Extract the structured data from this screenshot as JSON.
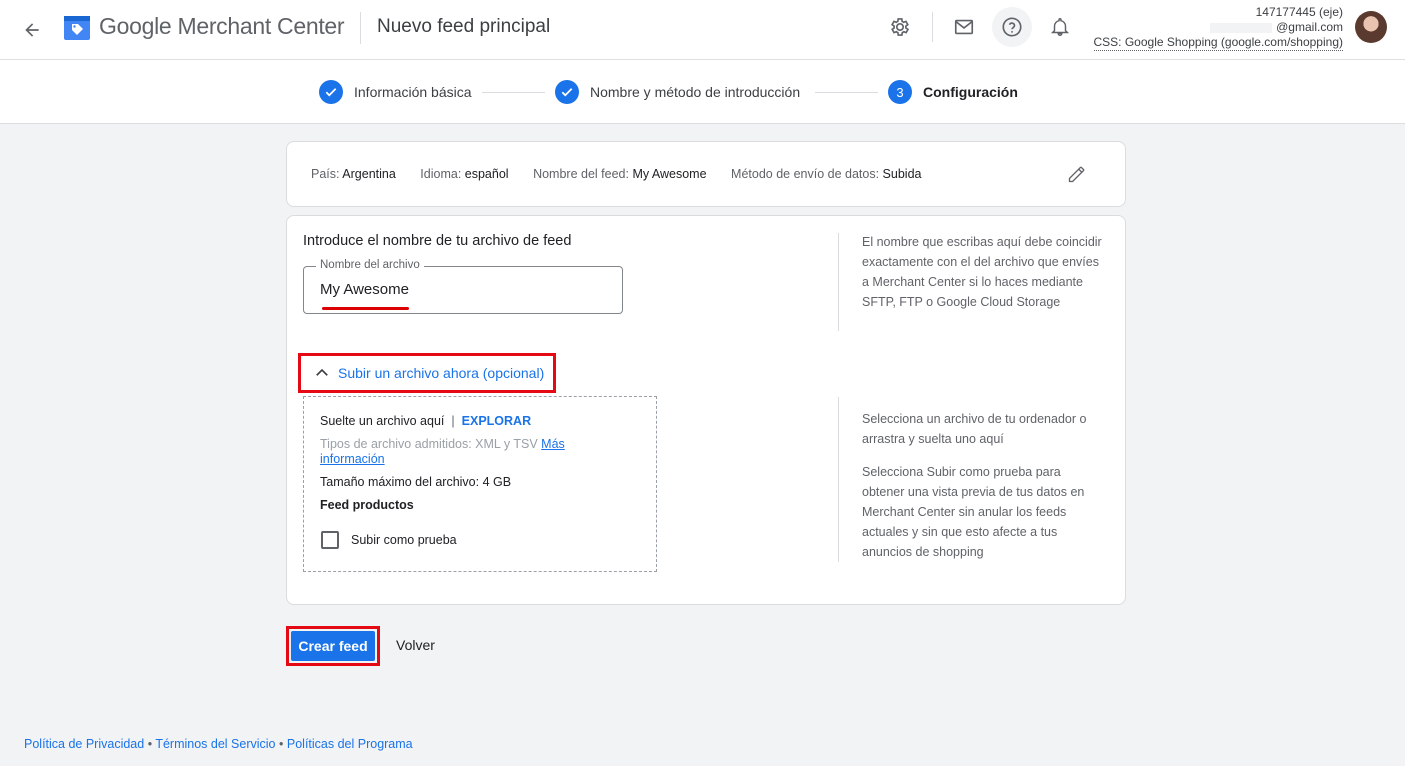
{
  "header": {
    "brand_google": "Google",
    "brand_product": "Merchant Center",
    "page_title": "Nuevo feed principal",
    "icons": [
      "back-arrow-icon",
      "settings-gear-icon",
      "mail-icon",
      "help-icon",
      "notifications-bell-icon"
    ],
    "account": {
      "id": "147177445 (eje)",
      "email": "@gmail.com",
      "css": "CSS: Google Shopping (google.com/shopping)"
    }
  },
  "stepper": {
    "steps": [
      {
        "label": "Información básica",
        "state": "done"
      },
      {
        "label": "Nombre y método de introducción",
        "state": "done"
      },
      {
        "label": "Configuración",
        "state": "current",
        "number": "3"
      }
    ]
  },
  "summary": {
    "country_label": "País:",
    "country_value": "Argentina",
    "language_label": "Idioma:",
    "language_value": "español",
    "feed_name_label": "Nombre del feed:",
    "feed_name_value": "My Awesome",
    "method_label": "Método de envío de datos:",
    "method_value": "Subida"
  },
  "form": {
    "section_title": "Introduce el nombre de tu archivo de feed",
    "filename_label": "Nombre del archivo",
    "filename_value": "My Awesome",
    "filename_help": "El nombre que escribas aquí debe coincidir exactamente con el del archivo que envíes a Merchant Center si lo haces mediante SFTP, FTP o Google Cloud Storage",
    "upload_toggle": "Subir un archivo ahora (opcional)",
    "drop_text": "Suelte un archivo aquí",
    "separator": "|",
    "browse": "EXPLORAR",
    "file_types": "Tipos de archivo admitidos: XML y TSV",
    "more_info": "Más información",
    "max_size": "Tamaño máximo del archivo: 4 GB",
    "feed_type": "Feed productos",
    "test_upload_label": "Subir como prueba",
    "test_upload_checked": false,
    "upload_help_1": "Selecciona un archivo de tu ordenador o arrastra y suelta uno aquí",
    "upload_help_2": "Selecciona Subir como prueba para obtener una vista previa de tus datos en Merchant Center sin anular los feeds actuales y sin que esto afecte a tus anuncios de shopping"
  },
  "actions": {
    "create": "Crear feed",
    "back": "Volver"
  },
  "footer": {
    "privacy": "Política de Privacidad",
    "terms": "Términos del Servicio",
    "program": "Políticas del Programa",
    "dot": "•"
  },
  "colors": {
    "accent": "#1a73e8",
    "highlight": "#e50914"
  }
}
